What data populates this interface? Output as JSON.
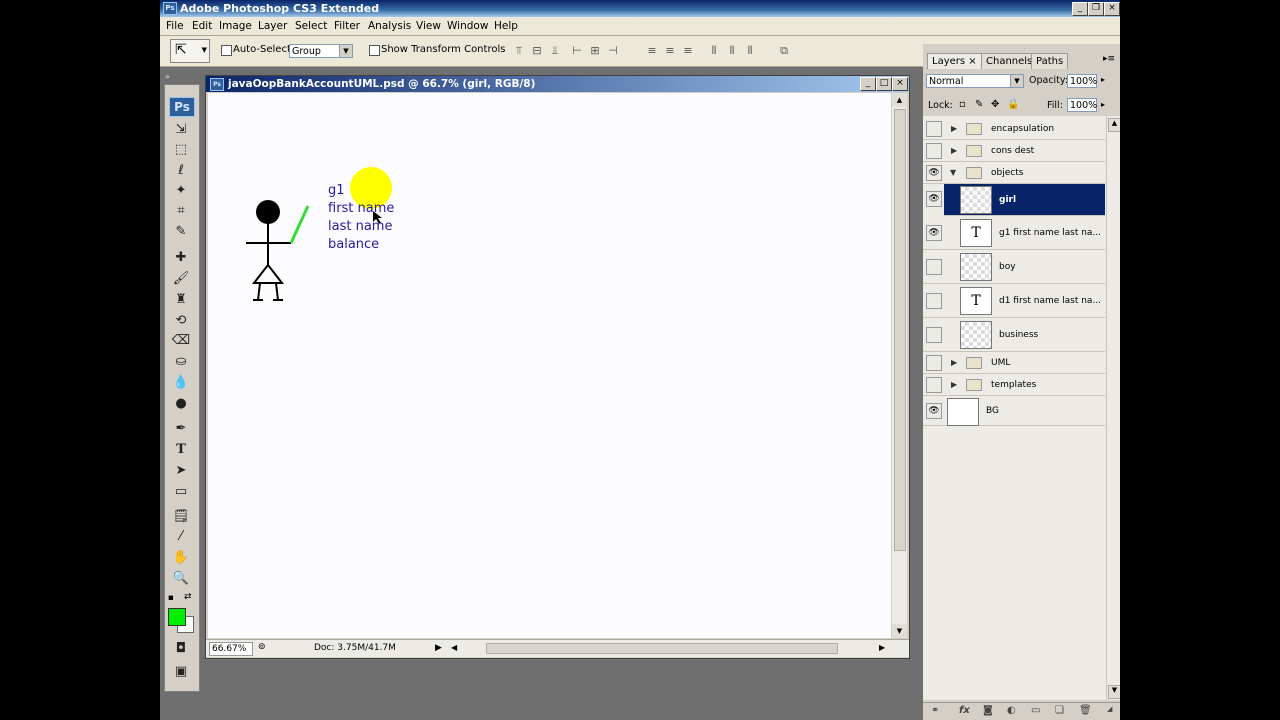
{
  "app": {
    "title": "Adobe Photoshop CS3 Extended",
    "icon": "Ps"
  },
  "menu": [
    "File",
    "Edit",
    "Image",
    "Layer",
    "Select",
    "Filter",
    "Analysis",
    "View",
    "Window",
    "Help"
  ],
  "options": {
    "auto_select": "Auto-Select:",
    "auto_select_value": "Group",
    "transform": "Show Transform Controls"
  },
  "toolbox": {
    "badge": "Ps"
  },
  "document": {
    "title": "javaOopBankAccountUML.psd @ 66.7% (girl, RGB/8)",
    "zoom": "66.67%",
    "doc_info": "Doc: 3.75M/41.7M",
    "uml_lines": [
      "g1",
      "first name",
      "last name",
      "balance"
    ]
  },
  "layers_panel": {
    "tabs": [
      "Layers ×",
      "Channels",
      "Paths"
    ],
    "blend_mode": "Normal",
    "opacity_label": "Opacity:",
    "opacity": "100%",
    "lock_label": "Lock:",
    "fill_label": "Fill:",
    "fill": "100%",
    "layers": [
      {
        "name": "encapsulation",
        "kind": "group",
        "visible": false
      },
      {
        "name": "cons dest",
        "kind": "group",
        "visible": false
      },
      {
        "name": "objects",
        "kind": "group-open",
        "visible": true
      },
      {
        "name": "girl",
        "kind": "pixel",
        "visible": true,
        "selected": true
      },
      {
        "name": "g1 first name last na...",
        "kind": "text",
        "visible": true
      },
      {
        "name": "boy",
        "kind": "pixel",
        "visible": false
      },
      {
        "name": "d1 first name last na...",
        "kind": "text",
        "visible": false
      },
      {
        "name": "business",
        "kind": "pixel",
        "visible": false
      },
      {
        "name": "UML",
        "kind": "group",
        "visible": false
      },
      {
        "name": "templates",
        "kind": "group",
        "visible": false
      },
      {
        "name": "BG",
        "kind": "background",
        "visible": true
      }
    ]
  },
  "colors": {
    "foreground": "#00ee00",
    "background": "#ffffff",
    "selection": "#0a246a",
    "highlight": "#ffff00"
  }
}
